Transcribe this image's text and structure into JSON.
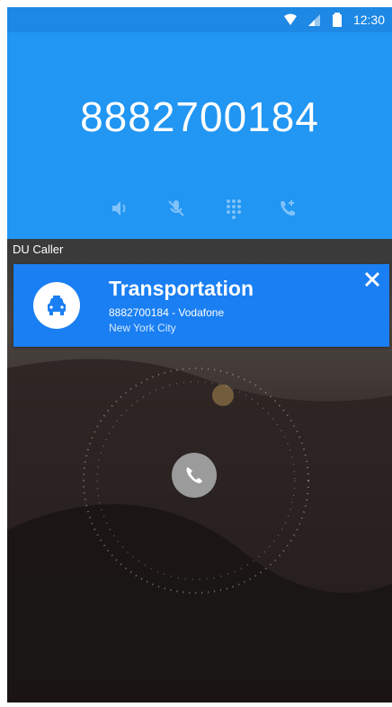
{
  "status_bar": {
    "time": "12:30",
    "icons": [
      "wifi-icon",
      "signal-icon",
      "battery-icon"
    ]
  },
  "call": {
    "number": "8882700184",
    "actions": [
      "speaker-icon",
      "mute-icon",
      "dialpad-icon",
      "add-call-icon"
    ]
  },
  "caller_app": {
    "label": "DU Caller"
  },
  "caller_card": {
    "title": "Transportation",
    "subtitle": "8882700184 - Vodafone",
    "location": "New York City",
    "icon": "taxi-icon",
    "close_icon": "close-icon"
  },
  "incoming": {
    "answer_icon": "phone-icon"
  },
  "colors": {
    "header_blue": "#2196f3",
    "card_blue": "#1a7ff2",
    "answer_grey": "#9b9b9b"
  }
}
